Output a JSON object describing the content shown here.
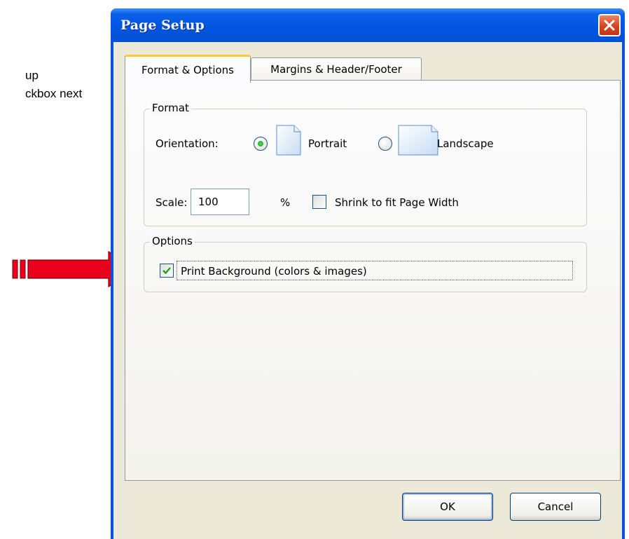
{
  "background_doc": {
    "line1": "up",
    "line2": "ckbox next"
  },
  "dialog": {
    "title": "Page Setup",
    "close_icon": "close-icon",
    "tabs": [
      {
        "label": "Format & Options",
        "active": true
      },
      {
        "label": "Margins & Header/Footer",
        "active": false
      }
    ],
    "format": {
      "group_label": "Format",
      "orientation_label": "Orientation:",
      "orientation_options": [
        {
          "label": "Portrait",
          "selected": true,
          "icon": "portrait-page-icon"
        },
        {
          "label": "Landscape",
          "selected": false,
          "icon": "landscape-page-icon"
        }
      ],
      "scale_label": "Scale:",
      "scale_value": "100",
      "scale_unit": "%",
      "shrink_label": "Shrink to fit Page Width",
      "shrink_checked": false
    },
    "options": {
      "group_label": "Options",
      "print_background_label": "Print Background (colors & images)",
      "print_background_checked": true
    },
    "buttons": {
      "ok": "OK",
      "cancel": "Cancel"
    }
  },
  "colors": {
    "title_bar": "#0254e0",
    "client": "#ece9d8",
    "arrow": "#e8001c",
    "close_button": "#d4451f"
  }
}
